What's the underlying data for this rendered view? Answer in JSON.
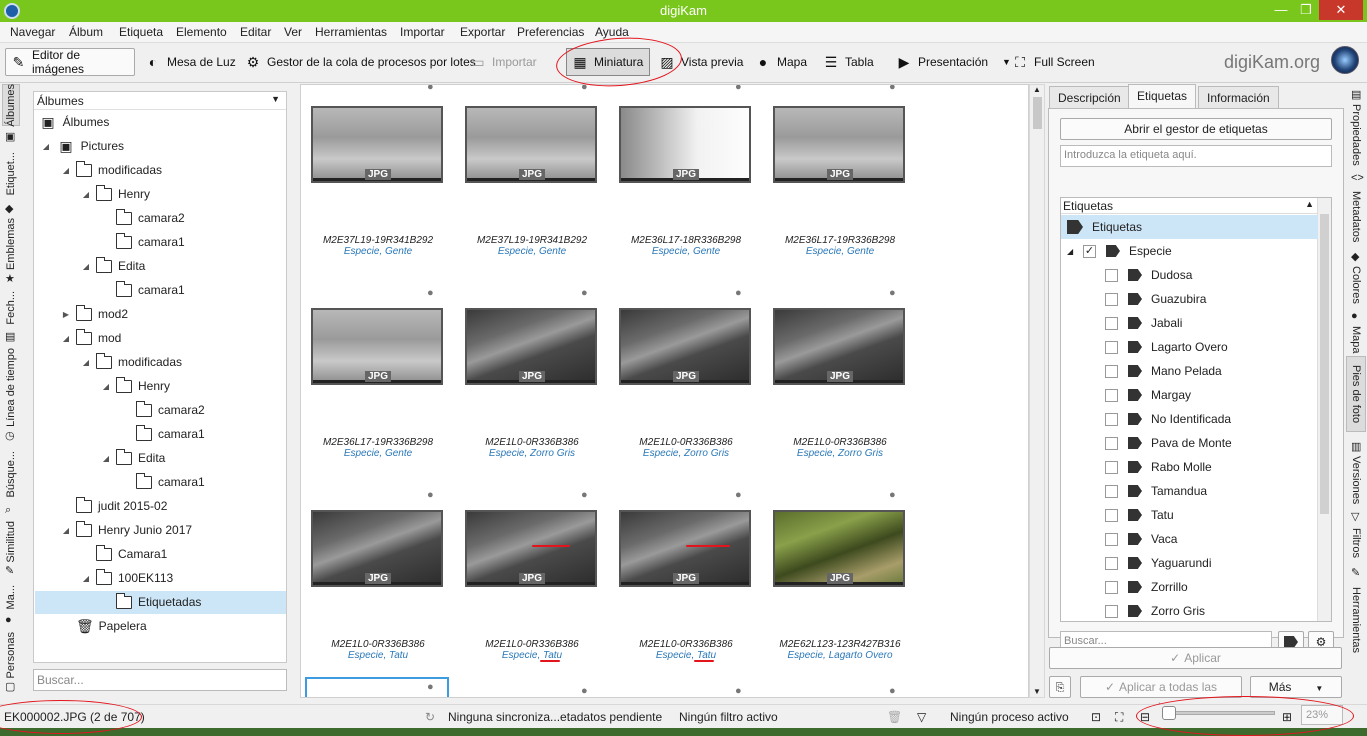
{
  "window": {
    "title": "digiKam",
    "minimize": "—",
    "maximize": "❐",
    "close": "✕"
  },
  "menu": [
    "Navegar",
    "Álbum",
    "Etiqueta",
    "Elemento",
    "Editar",
    "Ver",
    "Herramientas",
    "Importar",
    "Exportar",
    "Preferencias",
    "Ayuda"
  ],
  "toolbar": {
    "editor": "Editor de imágenes",
    "mesa": "Mesa de Luz",
    "gestor": "Gestor de la cola de procesos por lotes",
    "importar": "Importar",
    "miniatura": "Miniatura",
    "vista": "Vista previa",
    "mapa": "Mapa",
    "tabla": "Tabla",
    "presentacion": "Presentación",
    "fullscreen": "Full Screen",
    "brand": "digiKam.org"
  },
  "left_tabs": [
    "Álbumes",
    "Etiquet...",
    "Emblemas",
    "Fech...",
    "Línea de tiempo",
    "Búsque...",
    "Similitud",
    "Ma...",
    "Personas"
  ],
  "albums": {
    "header": "Álbumes",
    "items": [
      {
        "label": "Álbumes"
      },
      {
        "label": "Pictures"
      },
      {
        "label": "modificadas"
      },
      {
        "label": "Henry"
      },
      {
        "label": "camara2"
      },
      {
        "label": "camara1"
      },
      {
        "label": "Edita"
      },
      {
        "label": "camara1"
      },
      {
        "label": "mod2"
      },
      {
        "label": "mod"
      },
      {
        "label": "modificadas"
      },
      {
        "label": "Henry"
      },
      {
        "label": "camara2"
      },
      {
        "label": "camara1"
      },
      {
        "label": "Edita"
      },
      {
        "label": "camara1"
      },
      {
        "label": "judit 2015-02"
      },
      {
        "label": "Henry Junio 2017"
      },
      {
        "label": "Camara1"
      },
      {
        "label": "100EK113"
      },
      {
        "label": "Etiquetadas"
      },
      {
        "label": "Papelera"
      }
    ],
    "search_placeholder": "Buscar..."
  },
  "thumbnails": [
    {
      "name": "M2E37L19-19R341B292",
      "tags": "Especie, Gente",
      "badge": "JPG"
    },
    {
      "name": "M2E37L19-19R341B292",
      "tags": "Especie, Gente",
      "badge": "JPG"
    },
    {
      "name": "M2E36L17-18R336B298",
      "tags": "Especie, Gente",
      "badge": "JPG"
    },
    {
      "name": "M2E36L17-19R336B298",
      "tags": "Especie, Gente",
      "badge": "JPG"
    },
    {
      "name": "M2E36L17-19R336B298",
      "tags": "Especie, Gente",
      "badge": "JPG"
    },
    {
      "name": "M2E1L0-0R336B386",
      "tags": "Especie, Zorro Gris",
      "badge": "JPG"
    },
    {
      "name": "M2E1L0-0R336B386",
      "tags": "Especie, Zorro Gris",
      "badge": "JPG"
    },
    {
      "name": "M2E1L0-0R336B386",
      "tags": "Especie, Zorro Gris",
      "badge": "JPG"
    },
    {
      "name": "M2E1L0-0R336B386",
      "tags": "Especie, Tatu",
      "badge": "JPG"
    },
    {
      "name": "M2E1L0-0R336B386",
      "tags": "Especie, Tatu",
      "badge": "JPG"
    },
    {
      "name": "M2E1L0-0R336B386",
      "tags": "Especie, Tatu",
      "badge": "JPG"
    },
    {
      "name": "M2E62L123-123R427B316",
      "tags": "Especie, Lagarto Overo",
      "badge": "JPG"
    }
  ],
  "right_tabs": [
    "Propiedades",
    "Metadatos",
    "Colores",
    "Mapa",
    "Pies de foto",
    "Versiones",
    "Filtros",
    "Herramientas"
  ],
  "right_panel": {
    "tabs": [
      "Descripción",
      "Etiquetas",
      "Información"
    ],
    "open_manager": "Abrir el gestor de etiquetas",
    "tag_input_placeholder": "Introduzca la etiqueta aquí.",
    "list_header": "Etiquetas",
    "root": "Etiquetas",
    "parent": "Especie",
    "tags": [
      "Dudosa",
      "Guazubira",
      "Jabali",
      "Lagarto Overo",
      "Mano Pelada",
      "Margay",
      "No Identificada",
      "Pava de Monte",
      "Rabo Molle",
      "Tamandua",
      "Tatu",
      "Vaca",
      "Yaguarundi",
      "Zorrillo",
      "Zorro Gris"
    ],
    "search_placeholder": "Buscar...",
    "apply": "Aplicar",
    "apply_all": "Aplicar a todas las versiones",
    "more": "Más"
  },
  "status": {
    "file": "EK000002.JPG (2 de 707)",
    "sync": "Ninguna sincroniza...etadatos pendiente",
    "filter": "Ningún filtro activo",
    "process": "Ningún proceso activo",
    "zoom": "23%",
    "zoom_level": 0.05
  }
}
